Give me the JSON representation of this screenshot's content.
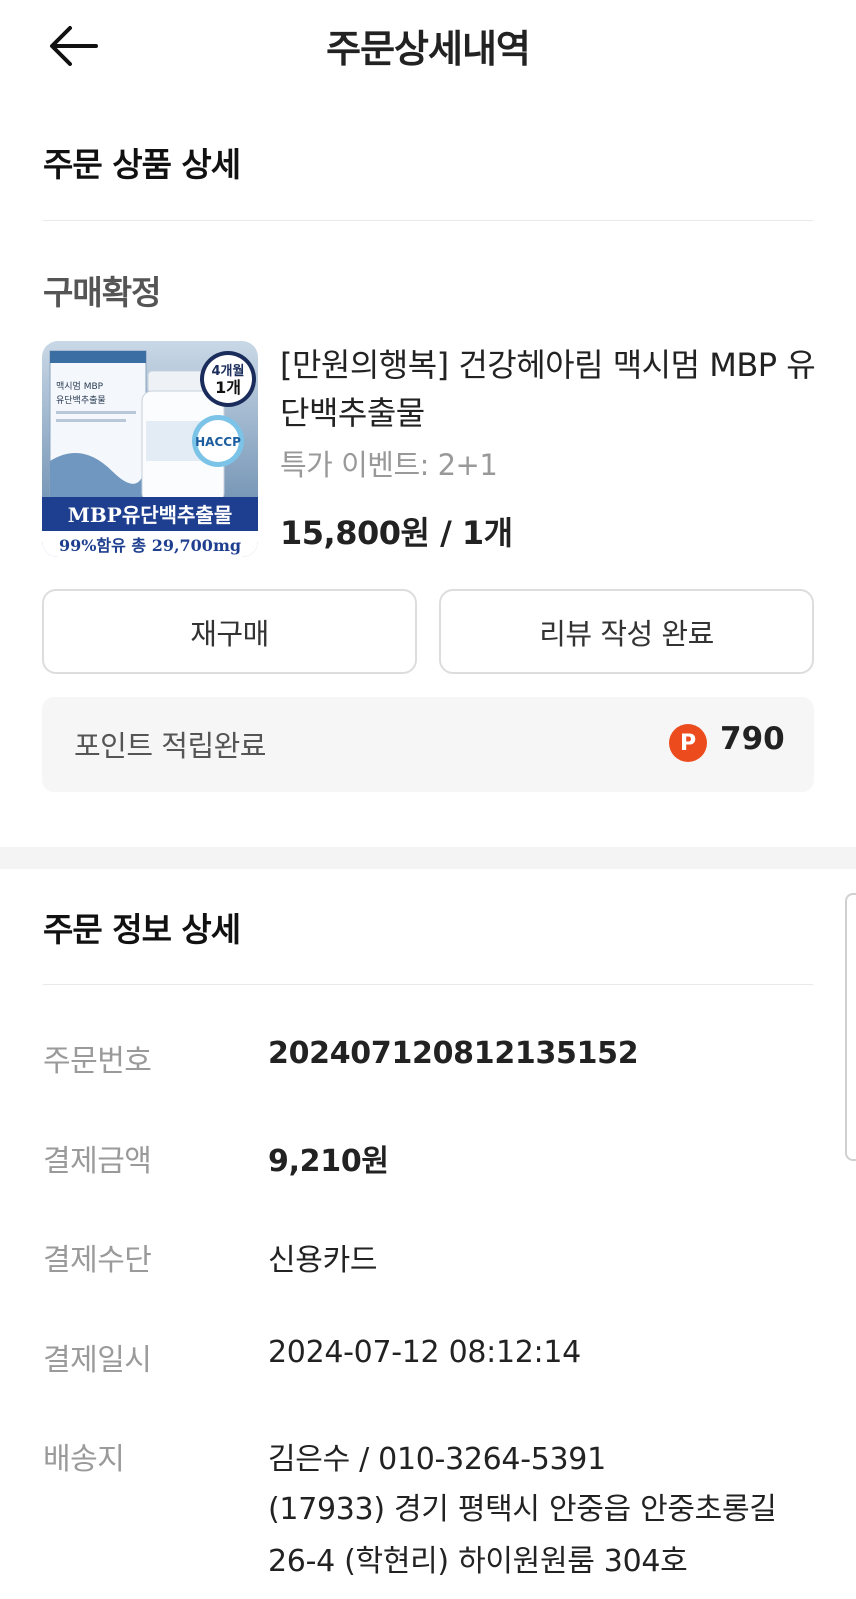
{
  "header": {
    "title": "주문상세내역"
  },
  "product_section": {
    "title": "주문 상품 상세",
    "status": "구매확정",
    "product": {
      "name": "[만원의행복] 건강헤아림 맥시멈 MBP 유단백추출물",
      "option": "특가 이벤트: 2+1",
      "price": "15,800원 / 1개",
      "thumbnail": {
        "box_top": "맥시멈 MBP",
        "box_sub": "유단백추출물",
        "badge_line1": "4개월",
        "badge_line2": "1개",
        "haccp": "HACCP",
        "banner_line1": "MBP유단백추출물",
        "banner_line2": "99%함유 총 29,700mg"
      }
    },
    "buttons": {
      "rebuy": "재구매",
      "review": "리뷰 작성 완료"
    },
    "points": {
      "label": "포인트 적립완료",
      "icon_letter": "P",
      "value": "790"
    }
  },
  "info_section": {
    "title": "주문 정보 상세",
    "rows": [
      {
        "label": "주문번호",
        "value": "20240712081213515​2"
      },
      {
        "label": "결제금액",
        "value": "9,210원"
      },
      {
        "label": "결제수단",
        "value": "신용카드"
      },
      {
        "label": "결제일시",
        "value": "2024-07-12 08:12:14"
      },
      {
        "label": "배송지",
        "value": "김은수 / 010-3264-5391"
      }
    ],
    "address": "(17933) 경기 평택시 안중읍 안중초롱길 26-4 (학현리) 하이원원룸 304호"
  },
  "colors": {
    "accent": "#ec4b1e",
    "label_gray": "#9a9a9a",
    "divider": "#e9e9e9"
  }
}
